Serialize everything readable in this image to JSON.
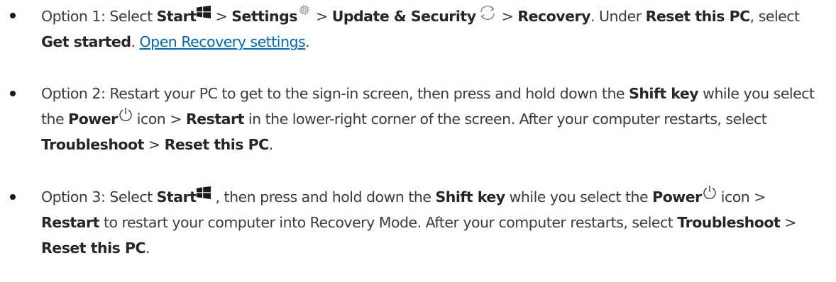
{
  "icons": {
    "start": "windows-start-icon",
    "settings": "gear-icon",
    "update": "sync-icon",
    "power": "power-icon"
  },
  "colors": {
    "text": "#3b3b3b",
    "link": "#0067b8",
    "icon_dark": "#1a1a1a",
    "icon_gray": "#7a7a7a"
  },
  "option1": {
    "prefix": "Option 1: Select ",
    "start": "Start",
    "sep1": " > ",
    "settings": "Settings",
    "sep2": " > ",
    "update": "Update & Security",
    "sep3": " > ",
    "recovery": "Recovery",
    "under": ". Under ",
    "reset_pc": "Reset this PC",
    "select": ", select ",
    "get_started": "Get started",
    "period": ". ",
    "link": "Open Recovery settings",
    "end": "."
  },
  "option2": {
    "prefix": "Option 2: Restart your PC to get to the sign-in screen, then press and hold down the ",
    "shift": "Shift key",
    "while": " while you select the ",
    "power": "Power",
    "icon": " icon > ",
    "restart": "Restart",
    "corner": " in the lower-right corner of the screen. After your computer restarts, select ",
    "troubleshoot": "Troubleshoot",
    "sep": " > ",
    "reset_pc": "Reset this PC",
    "end": "."
  },
  "option3": {
    "prefix": "Option 3: Select ",
    "start": "Start",
    "then": " , then press and hold down the ",
    "shift": "Shift key",
    "while": " while you select the ",
    "power": "Power",
    "icon": " icon > ",
    "restart": "Restart",
    "into": " to restart your computer into Recovery Mode. After your computer restarts, select ",
    "troubleshoot": "Troubleshoot",
    "sep": " > ",
    "reset_pc": "Reset this PC",
    "end": "."
  }
}
